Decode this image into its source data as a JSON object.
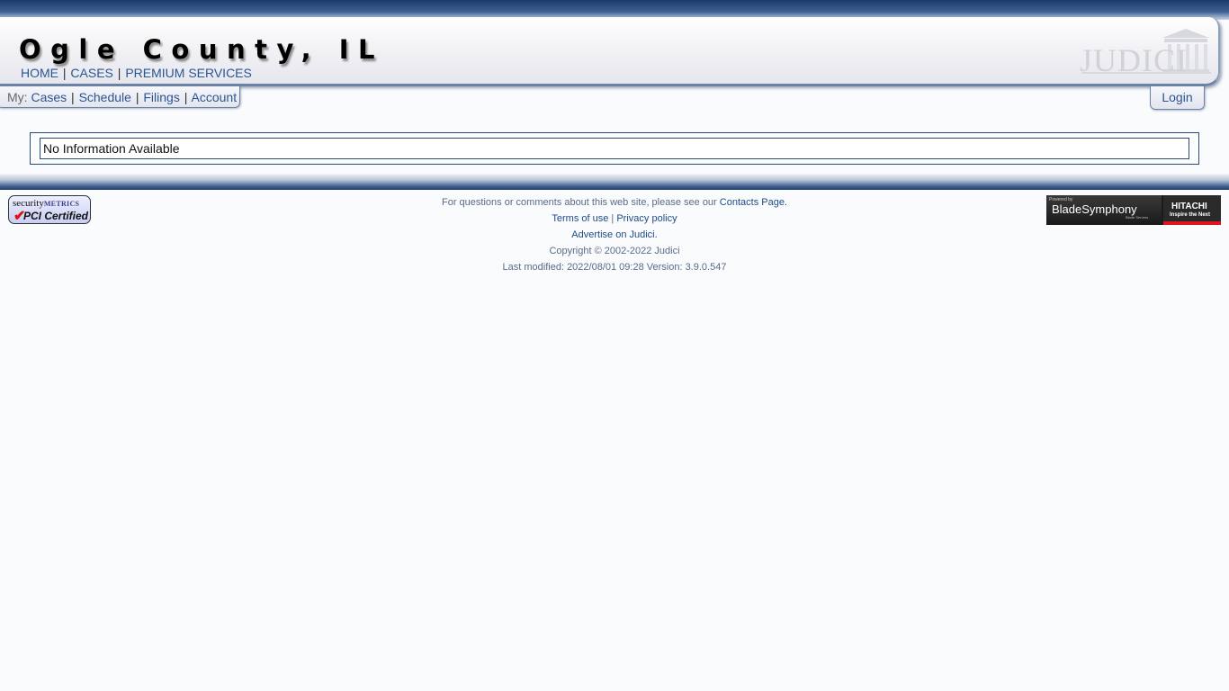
{
  "header": {
    "title": "Ogle County, IL",
    "nav": [
      "HOME",
      "CASES",
      "PREMIUM SERVICES"
    ],
    "separator": "|",
    "logo_text": "JUDICI"
  },
  "subnav": {
    "prefix": "My:",
    "items": [
      "Cases",
      "Schedule",
      "Filings",
      "Account"
    ],
    "login_label": "Login"
  },
  "content": {
    "message": "No Information Available"
  },
  "footer": {
    "questions_text": "For questions or comments about this web site, please see our ",
    "contacts_link": "Contacts Page.",
    "terms_link": "Terms of use",
    "privacy_link": "Privacy policy",
    "advertise_link": "Advertise on Judici.",
    "copyright": "Copyright © 2002-2022 Judici",
    "last_modified": "Last modified: 2022/08/01 09:28 Version: 3.9.0.547"
  },
  "badges": {
    "security_top": "security",
    "security_metrics": "METRICS",
    "security_pci": "PCI Certified",
    "blade_powered": "Powered by",
    "blade_name": "BladeSymphony",
    "blade_sub": "Blade Servers",
    "hitachi": "HITACHI",
    "hitachi_tagline": "Inspire the Next"
  },
  "colors": {
    "link": "#2b5592",
    "header_dark": "#1a3a6a",
    "border": "#2b4a78",
    "hitachi_red": "#e0141e"
  }
}
